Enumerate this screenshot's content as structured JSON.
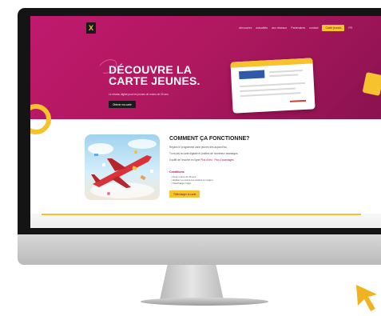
{
  "website": {
    "logo": "X",
    "nav": {
      "items": [
        "découvrez",
        "actualités",
        "aux réseaux",
        "Partenaires",
        "contact"
      ],
      "cta": "Carte jeunes",
      "language": "FR"
    },
    "hero": {
      "title_line1": "DÉCOUVRE LA",
      "title_line2": "CARTE JEUNES.",
      "subtitle": "Le réseau digital pour les jeunes de moins de 26 ans.",
      "button": "Obtenir ma carte"
    },
    "section": {
      "title": "COMMENT ÇA FONCTIONNE?",
      "p1": "Rejoins le programme carte jeunes dès aujourd'hui.",
      "p2": "Tu reçois ta carte digitale et profites de nombreux avantages.",
      "p3_prefix": "Il suffit de t'inscrire en ligne",
      "p3_highlight": "Plus d'info : Plus d'avantages",
      "conditions_title": "Conditions",
      "conditions": [
        "Avoir moins de 26 ans.",
        "Habiter ou suivre tes études en région.",
        "Télécharger l'app."
      ],
      "download_button": "Télécharger la carte"
    }
  },
  "colors": {
    "accent": "#b0185f",
    "yellow": "#f6c32f",
    "cursor": "#f0b21f"
  },
  "icons": [
    "cursor-arrow-icon"
  ]
}
